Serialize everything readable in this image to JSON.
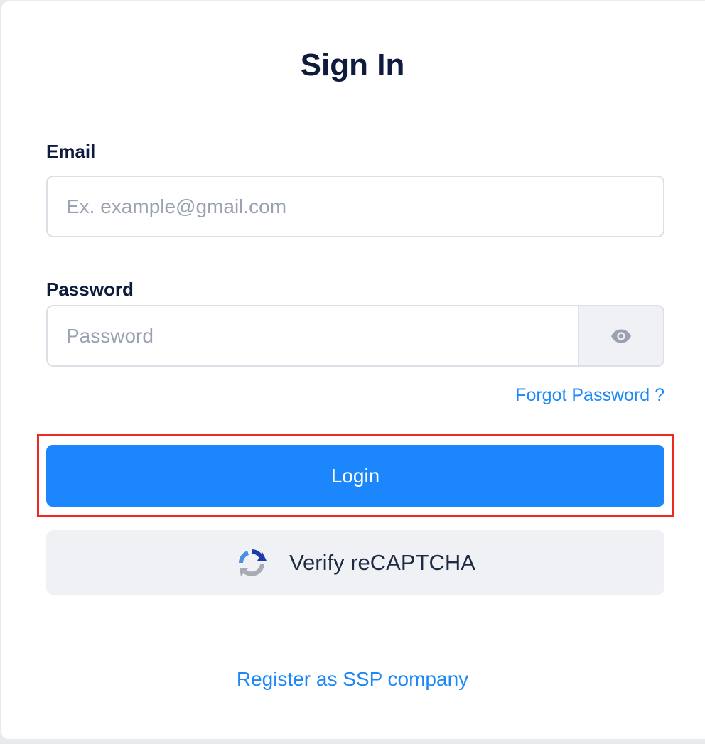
{
  "form": {
    "title": "Sign In",
    "email": {
      "label": "Email",
      "placeholder": "Ex. example@gmail.com",
      "value": ""
    },
    "password": {
      "label": "Password",
      "placeholder": "Password",
      "value": "",
      "toggle_icon": "eye-icon"
    },
    "forgot_password_label": "Forgot Password ?",
    "login_label": "Login",
    "recaptcha": {
      "label": "Verify reCAPTCHA",
      "icon": "recaptcha-icon"
    },
    "register_label": "Register as SSP company"
  },
  "colors": {
    "accent": "#1c87fd",
    "title_text": "#0f1b3d",
    "link": "#1c87f5",
    "highlight_border": "#ec2a20",
    "secondary_button_bg": "#f0f1f5"
  }
}
